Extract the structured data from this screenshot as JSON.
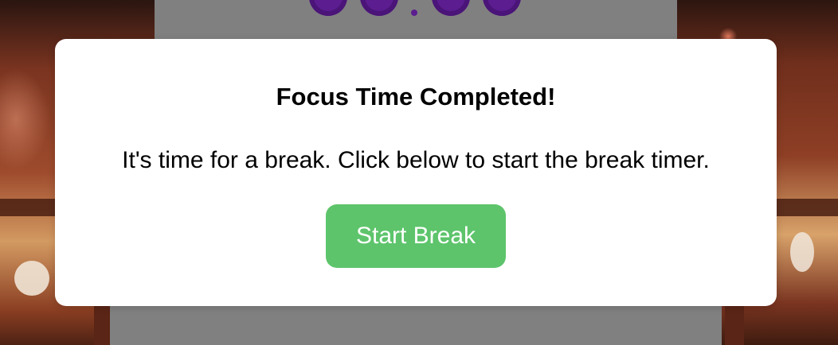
{
  "modal": {
    "title": "Focus Time Completed!",
    "message": "It's time for a break. Click below to start the break timer.",
    "button_label": "Start Break"
  },
  "colors": {
    "button": "#5dc46b",
    "timer_digits": "#5b1d8f",
    "panel": "#808080",
    "modal_background": "#ffffff"
  }
}
